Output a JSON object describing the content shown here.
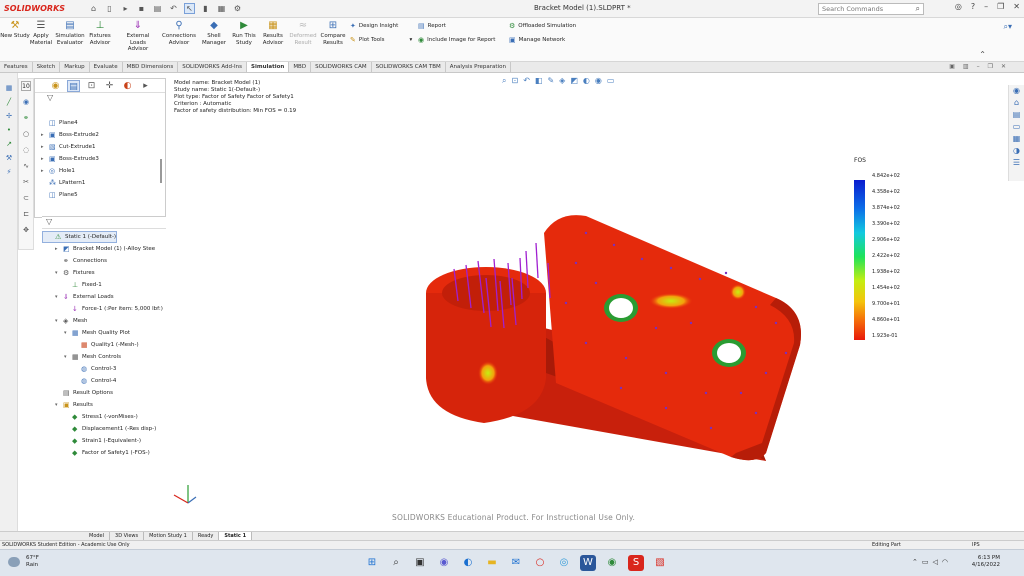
{
  "app": {
    "logo": "SOLIDWORKS",
    "title": "Bracket Model (1).SLDPRT *",
    "search_placeholder": "Search Commands"
  },
  "ribbon": {
    "big_buttons": [
      {
        "label": "New Study",
        "icon": "new-study-icon"
      },
      {
        "label": "Apply Material",
        "icon": "apply-material-icon"
      },
      {
        "label": "Simulation Evaluator",
        "icon": "evaluator-icon"
      },
      {
        "label": "Fixtures Advisor",
        "icon": "fixtures-icon"
      },
      {
        "label": "External Loads Advisor",
        "icon": "loads-icon"
      },
      {
        "label": "Connections Advisor",
        "icon": "connections-icon"
      },
      {
        "label": "Shell Manager",
        "icon": "shell-icon"
      },
      {
        "label": "Run This Study",
        "icon": "run-icon"
      },
      {
        "label": "Results Advisor",
        "icon": "results-icon"
      },
      {
        "label": "Deformed Result",
        "icon": "deformed-icon",
        "disabled": true
      },
      {
        "label": "Compare Results",
        "icon": "compare-icon"
      }
    ],
    "small": {
      "design_insight": "Design Insight",
      "plot_tools": "Plot Tools",
      "report": "Report",
      "include_image": "Include Image for Report",
      "offloaded": "Offloaded Simulation",
      "manage_network": "Manage Network"
    }
  },
  "tabs": [
    "Features",
    "Sketch",
    "Markup",
    "Evaluate",
    "MBD Dimensions",
    "SOLIDWORKS Add-Ins",
    "Simulation",
    "MBD",
    "SOLIDWORKS CAM",
    "SOLIDWORKS CAM TBM",
    "Analysis Preparation"
  ],
  "active_tab": "Simulation",
  "feature_tree": [
    {
      "label": "Plane4",
      "icon": "plane-icon",
      "arrow": ""
    },
    {
      "label": "Boss-Extrude2",
      "icon": "extrude-icon",
      "arrow": "▸"
    },
    {
      "label": "Cut-Extrude1",
      "icon": "cut-extrude-icon",
      "arrow": "▸"
    },
    {
      "label": "Boss-Extrude3",
      "icon": "extrude-icon",
      "arrow": "▸"
    },
    {
      "label": "Hole1",
      "icon": "hole-icon",
      "arrow": "▸"
    },
    {
      "label": "LPattern1",
      "icon": "pattern-icon",
      "arrow": ""
    },
    {
      "label": "Plane5",
      "icon": "plane-icon",
      "arrow": ""
    }
  ],
  "study_tree": [
    {
      "label": "Static 1 (-Default-)",
      "indent": 0,
      "arrow": "",
      "selected": true
    },
    {
      "label": "Bracket Model (1) (-Alloy Stee",
      "indent": 1,
      "arrow": "▸"
    },
    {
      "label": "Connections",
      "indent": 1,
      "arrow": ""
    },
    {
      "label": "Fixtures",
      "indent": 1,
      "arrow": "▾"
    },
    {
      "label": "Fixed-1",
      "indent": 2,
      "arrow": ""
    },
    {
      "label": "External Loads",
      "indent": 1,
      "arrow": "▾"
    },
    {
      "label": "Force-1 (:Per item: 5,000 lbf:)",
      "indent": 2,
      "arrow": ""
    },
    {
      "label": "Mesh",
      "indent": 1,
      "arrow": "▾"
    },
    {
      "label": "Mesh Quality Plot",
      "indent": 2,
      "arrow": "▾"
    },
    {
      "label": "Quality1 (-Mesh-)",
      "indent": 3,
      "arrow": ""
    },
    {
      "label": "Mesh Controls",
      "indent": 2,
      "arrow": "▾"
    },
    {
      "label": "Control-3",
      "indent": 3,
      "arrow": ""
    },
    {
      "label": "Control-4",
      "indent": 3,
      "arrow": ""
    },
    {
      "label": "Result Options",
      "indent": 1,
      "arrow": ""
    },
    {
      "label": "Results",
      "indent": 1,
      "arrow": "▾"
    },
    {
      "label": "Stress1 (-vonMises-)",
      "indent": 2,
      "arrow": ""
    },
    {
      "label": "Displacement1 (-Res disp-)",
      "indent": 2,
      "arrow": ""
    },
    {
      "label": "Strain1 (-Equivalent-)",
      "indent": 2,
      "arrow": ""
    },
    {
      "label": "Factor of Safety1 (-FOS-)",
      "indent": 2,
      "arrow": ""
    }
  ],
  "plot_info": [
    "Model name: Bracket Model (1)",
    "Study name: Static 1(-Default-)",
    "Plot type: Factor of Safety Factor of Safety1",
    "Criterion : Automatic",
    "Factor of safety distribution: Min FOS = 0.19"
  ],
  "legend": {
    "title": "FOS",
    "labels": [
      "4.842e+02",
      "4.358e+02",
      "3.874e+02",
      "3.390e+02",
      "2.906e+02",
      "2.422e+02",
      "1.938e+02",
      "1.454e+02",
      "9.700e+01",
      "4.860e+01",
      "1.923e-01"
    ]
  },
  "watermark": "SOLIDWORKS Educational Product. For Instructional Use Only.",
  "bottom_tabs": [
    "Model",
    "3D Views",
    "Motion Study 1",
    "Ready",
    "Static 1"
  ],
  "status": {
    "left": "SOLIDWORKS Student Edition - Academic Use Only",
    "mode": "Editing Part",
    "units": "IPS"
  },
  "taskbar": {
    "temp": "67°F",
    "weather": "Rain",
    "time": "6:13 PM",
    "date": "4/16/2022"
  }
}
